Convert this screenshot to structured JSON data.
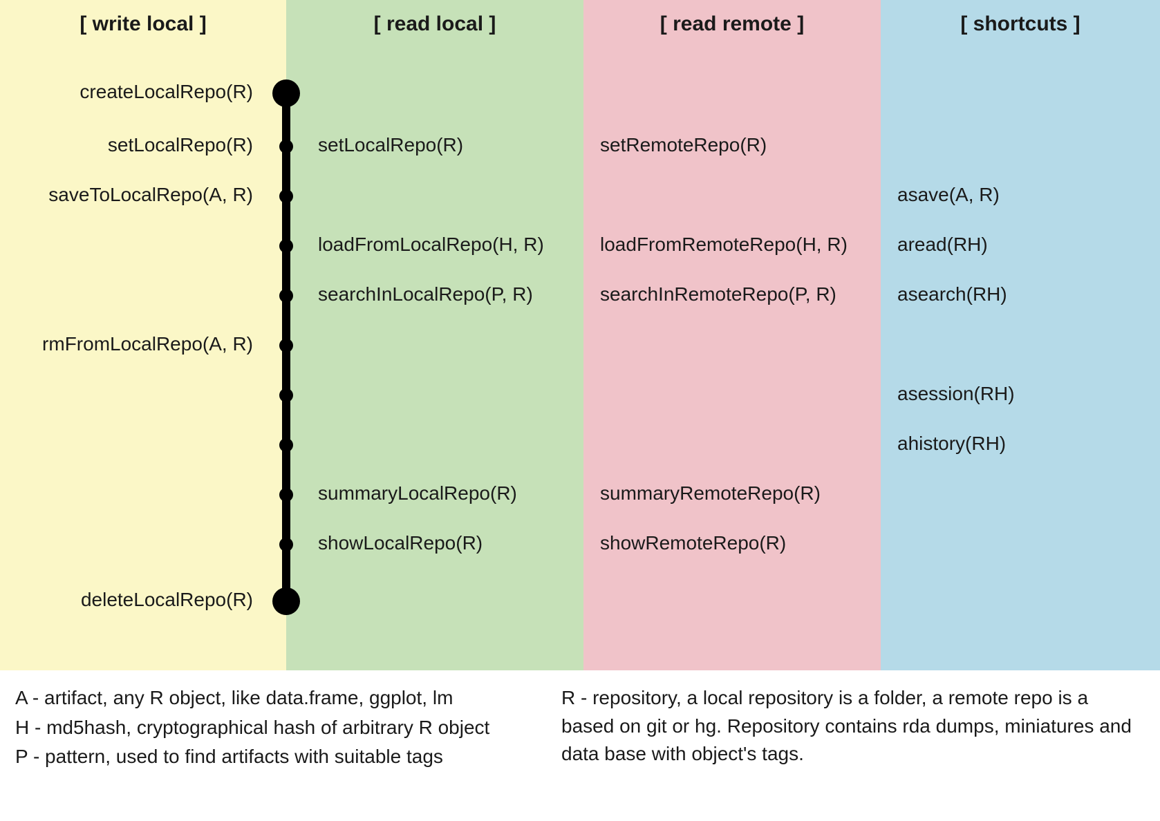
{
  "columns": {
    "write_local": {
      "header": "[ write local ]"
    },
    "read_local": {
      "header": "[ read local ]"
    },
    "read_remote": {
      "header": "[ read remote ]"
    },
    "shortcuts": {
      "header": "[ shortcuts ]"
    }
  },
  "rows": [
    {
      "write_local": "createLocalRepo(R)",
      "read_local": "",
      "read_remote": "",
      "shortcuts": "",
      "node_size": "big"
    },
    {
      "write_local": "setLocalRepo(R)",
      "read_local": "setLocalRepo(R)",
      "read_remote": "setRemoteRepo(R)",
      "shortcuts": "",
      "node_size": "small"
    },
    {
      "write_local": "saveToLocalRepo(A, R)",
      "read_local": "",
      "read_remote": "",
      "shortcuts": "asave(A, R)",
      "node_size": "small"
    },
    {
      "write_local": "",
      "read_local": "loadFromLocalRepo(H, R)",
      "read_remote": "loadFromRemoteRepo(H, R)",
      "shortcuts": "aread(RH)",
      "node_size": "small"
    },
    {
      "write_local": "",
      "read_local": "searchInLocalRepo(P, R)",
      "read_remote": "searchInRemoteRepo(P, R)",
      "shortcuts": "asearch(RH)",
      "node_size": "small"
    },
    {
      "write_local": "rmFromLocalRepo(A, R)",
      "read_local": "",
      "read_remote": "",
      "shortcuts": "",
      "node_size": "small"
    },
    {
      "write_local": "",
      "read_local": "",
      "read_remote": "",
      "shortcuts": "asession(RH)",
      "node_size": "small"
    },
    {
      "write_local": "",
      "read_local": "",
      "read_remote": "",
      "shortcuts": "ahistory(RH)",
      "node_size": "small"
    },
    {
      "write_local": "",
      "read_local": "summaryLocalRepo(R)",
      "read_remote": "summaryRemoteRepo(R)",
      "shortcuts": "",
      "node_size": "small"
    },
    {
      "write_local": "",
      "read_local": "showLocalRepo(R)",
      "read_remote": "showRemoteRepo(R)",
      "shortcuts": "",
      "node_size": "small"
    },
    {
      "write_local": "deleteLocalRepo(R)",
      "read_local": "",
      "read_remote": "",
      "shortcuts": "",
      "node_size": "big"
    }
  ],
  "legend": {
    "A": "A  - artifact, any R object, like data.frame, ggplot, lm",
    "H": "H  - md5hash, cryptographical hash of arbitrary R object",
    "P": "P  - pattern, used to find artifacts with suitable tags",
    "R": "R  - repository, a local repository is a folder, a remote repo is a based on git or hg. Repository contains rda dumps, miniatures and data base with object's tags."
  },
  "chart_data": {
    "type": "table",
    "title": "R function cheat sheet for local/remote repository operations",
    "columns": [
      "write local",
      "read local",
      "read remote",
      "shortcuts"
    ],
    "rows": [
      [
        "createLocalRepo(R)",
        "",
        "",
        ""
      ],
      [
        "setLocalRepo(R)",
        "setLocalRepo(R)",
        "setRemoteRepo(R)",
        ""
      ],
      [
        "saveToLocalRepo(A, R)",
        "",
        "",
        "asave(A, R)"
      ],
      [
        "",
        "loadFromLocalRepo(H, R)",
        "loadFromRemoteRepo(H, R)",
        "aread(RH)"
      ],
      [
        "",
        "searchInLocalRepo(P, R)",
        "searchInRemoteRepo(P, R)",
        "asearch(RH)"
      ],
      [
        "rmFromLocalRepo(A, R)",
        "",
        "",
        ""
      ],
      [
        "",
        "",
        "",
        "asession(RH)"
      ],
      [
        "",
        "",
        "",
        "ahistory(RH)"
      ],
      [
        "",
        "summaryLocalRepo(R)",
        "summaryRemoteRepo(R)",
        ""
      ],
      [
        "",
        "showLocalRepo(R)",
        "showRemoteRepo(R)",
        ""
      ],
      [
        "deleteLocalRepo(R)",
        "",
        "",
        ""
      ]
    ],
    "node_sizes": [
      "big",
      "small",
      "small",
      "small",
      "small",
      "small",
      "small",
      "small",
      "small",
      "small",
      "big"
    ],
    "legend": {
      "A": "artifact, any R object, like data.frame, ggplot, lm",
      "H": "md5hash, cryptographical hash of arbitrary R object",
      "P": "pattern, used to find artifacts with suitable tags",
      "R": "repository, a local repository is a folder, a remote repo is a based on git or hg. Repository contains rda dumps, miniatures and data base with object's tags."
    }
  }
}
